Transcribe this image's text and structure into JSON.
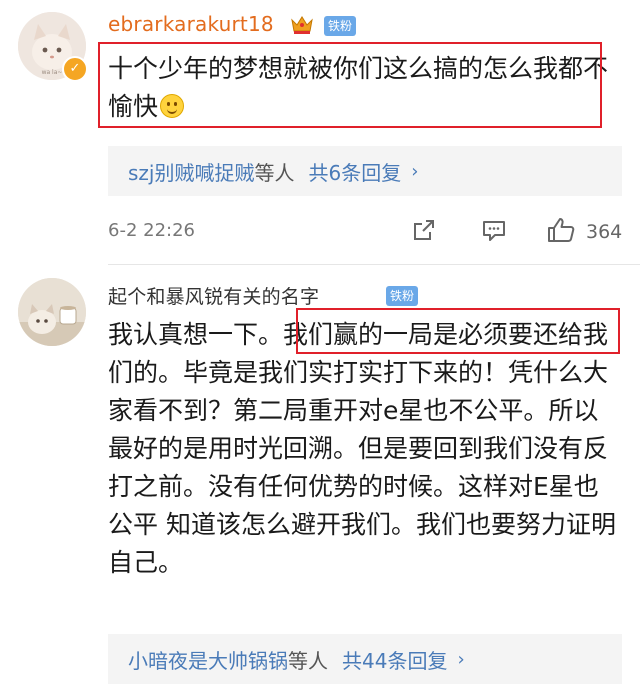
{
  "comments": [
    {
      "username": "ebrarkarakurt18",
      "badge": "铁粉",
      "text": "十个少年的梦想就被你们这么搞的怎么我都不愉快",
      "emoji": "smile-emoji",
      "replies": {
        "name": "szj别贼喊捉贼",
        "mid": "等人",
        "count": "共6条回复",
        "chevron": "›"
      },
      "timestamp": "6-2 22:26",
      "likes": "364",
      "verified_icon": "check-icon"
    },
    {
      "username": "起个和暴风锐有关的名字",
      "badge": "铁粉",
      "text": "我认真想一下。我们赢的一局是必须要还给我们的。毕竟是我们实打实打下来的！凭什么大家看不到？第二局重开对e星也不公平。所以最好的是用时光回溯。但是要回到我们没有反打之前。没有任何优势的时候。这样对E星也公平 知道该怎么避开我们。我们也要努力证明自己。",
      "replies": {
        "name": "小暗夜是大帅锅锅",
        "mid": "等人",
        "count": "共44条回复",
        "chevron": "›"
      }
    }
  ],
  "colors": {
    "username_orange": "#e36c1e",
    "link_blue": "#4a7bb8",
    "badge_blue": "#6aa8e8",
    "highlight_red": "#e0202a"
  },
  "icons": [
    "share-icon",
    "comment-icon",
    "thumbs-up-icon",
    "vip-crown-icon"
  ]
}
